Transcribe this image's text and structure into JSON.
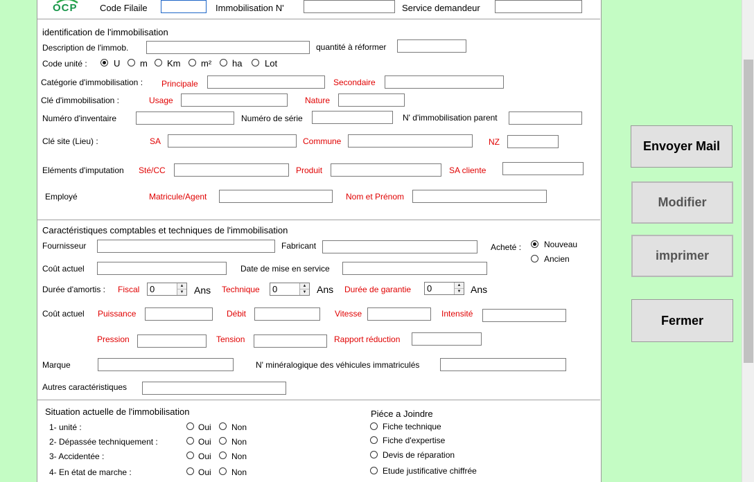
{
  "header": {
    "logo_text": "OCP",
    "code_filiale_label": "Code Filaile",
    "immobilisation_no_label": "Immobilisation N'",
    "service_label": "Service demandeur"
  },
  "identification": {
    "title": "identification de l'immobilisation",
    "description_label": "Description de l'immob.",
    "quantite_label": "quantité à réformer",
    "code_unite_label": "Code unité  :",
    "units": [
      "U",
      "m",
      "Km",
      "m²",
      "ha",
      "Lot"
    ],
    "selected_unit": "U",
    "categorie_label": "Catégorie d'immobilisation :",
    "principale_label": "Principale",
    "secondaire_label": "Secondaire",
    "cle_label": "Clé d'immobilisation :",
    "usage_label": "Usage",
    "nature_label": "Nature",
    "inventaire_label": "Numéro d'inventaire",
    "serie_label": "Numéro de série",
    "parent_label": "N' d'immobilisation parent",
    "site_label": "Clé site (Lieu) :",
    "sa_label": "SA",
    "commune_label": "Commune",
    "nz_label": "NZ",
    "imputation_label": "Eléments d'imputation",
    "ste_label": "Sté/CC",
    "produit_label": "Produit",
    "sa_cliente_label": "SA cliente",
    "employe_label": "Employé",
    "matricule_label": "Matricule/Agent",
    "nom_label": "Nom et Prénom"
  },
  "caracteristiques": {
    "title": "Caractéristiques comptables et techniques de l'immobilisation",
    "fournisseur_label": "Fournisseur",
    "fabricant_label": "Fabricant",
    "achete_label": "Acheté :",
    "achete_options": [
      "Nouveau",
      "Ancien"
    ],
    "achete_selected": "Nouveau",
    "cout_actuel_label": "Coût actuel",
    "date_service_label": "Date de mise en service",
    "duree_label": "Durée d'amortis :",
    "fiscal_label": "Fiscal",
    "fiscal_value": "0",
    "technique_label": "Technique",
    "technique_value": "0",
    "garantie_label": "Durée de garantie",
    "garantie_value": "0",
    "ans_label": "Ans",
    "cout_actuel2_label": "Coût actuel",
    "puissance_label": "Puissance",
    "debit_label": "Débit",
    "vitesse_label": "Vitesse",
    "intensite_label": "Intensité",
    "pression_label": "Pression",
    "tension_label": "Tension",
    "rapport_label": "Rapport réduction",
    "marque_label": "Marque",
    "mineralogique_label": "N' minéralogique des véhicules immatriculés",
    "autres_label": "Autres caractéristiques"
  },
  "situation": {
    "title": "Situation actuelle de l'immobilisation",
    "items": [
      {
        "label": "1- unité  :"
      },
      {
        "label": "2- Dépassée techniquement  :"
      },
      {
        "label": "3- Accidentée  :"
      },
      {
        "label": "4- En état de marche  :"
      }
    ],
    "oui_label": "Oui",
    "non_label": "Non"
  },
  "pieces": {
    "title": "Piéce a Joindre",
    "items": [
      "Fiche technique",
      "Fiche d'expertise",
      "Devis de réparation",
      "Etude justificative chiffrée"
    ]
  },
  "actions": {
    "envoyer": "Envoyer Mail",
    "modifier": "Modifier",
    "imprimer": "imprimer",
    "fermer": "Fermer"
  }
}
